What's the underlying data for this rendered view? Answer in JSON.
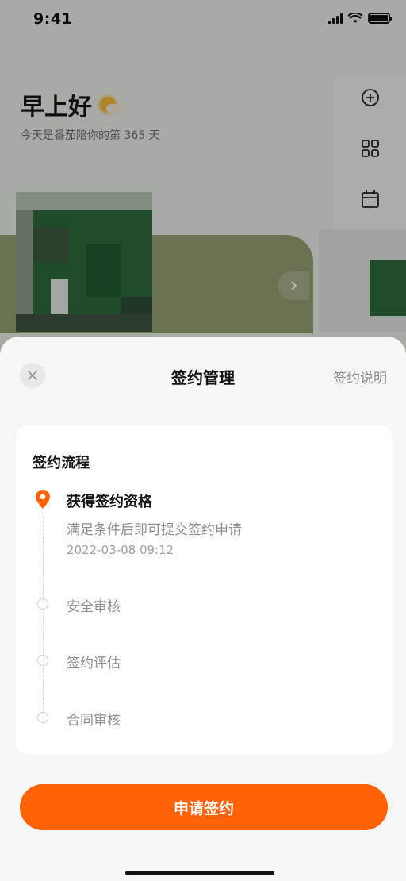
{
  "status_bar": {
    "time": "9:41"
  },
  "background": {
    "greeting": "早上好",
    "subtitle": "今天是番茄陪你的第 365 天",
    "side_icons": [
      "plus-circle-icon",
      "grid-icon",
      "calendar-icon"
    ]
  },
  "sheet": {
    "title": "签约管理",
    "help_link": "签约说明",
    "process": {
      "title": "签约流程",
      "steps": [
        {
          "label": "获得签约资格",
          "description": "满足条件后即可提交签约申请",
          "time": "2022-03-08 09:12",
          "active": true
        },
        {
          "label": "安全审核",
          "active": false
        },
        {
          "label": "签约评估",
          "active": false
        },
        {
          "label": "合同审核",
          "active": false
        }
      ]
    },
    "apply_button": "申请签约"
  },
  "colors": {
    "accent": "#ff6306",
    "sheet_bg": "#f6f6f6",
    "card_bg": "#ffffff"
  }
}
